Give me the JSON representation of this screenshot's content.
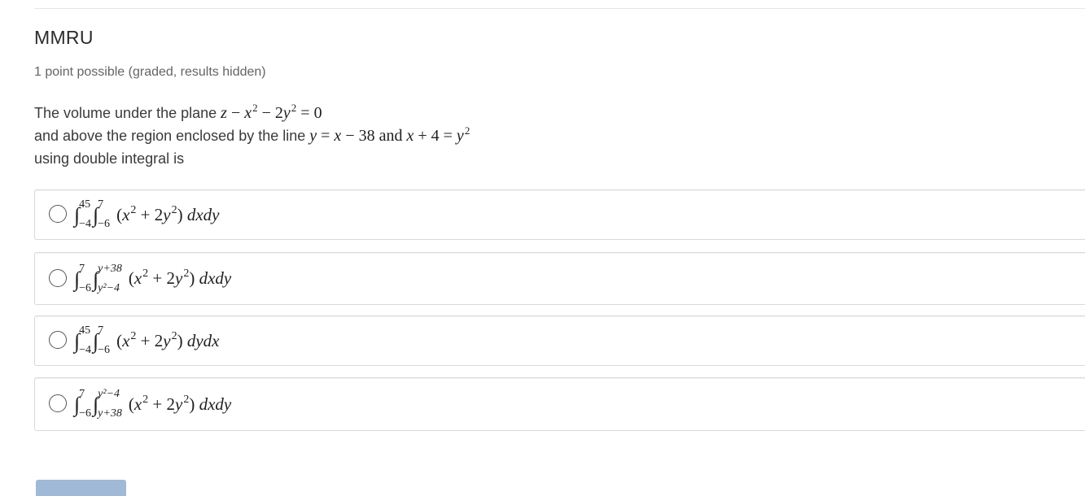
{
  "problem": {
    "title": "MMRU",
    "meta": "1 point possible (graded, results hidden)",
    "line1_text": "The volume under the plane ",
    "line1_math": {
      "a": "z",
      "op1": " − ",
      "b": "x",
      "exp1": "2",
      "op2": " − 2",
      "c": "y",
      "exp2": "2",
      "eq": " = 0"
    },
    "line2_text": "and above the region enclosed by the line ",
    "line2_math": {
      "y": "y",
      "eq": " = ",
      "x": "x",
      "rest": " − 38 and ",
      "x2": "x",
      "rest2": " + 4 = ",
      "y2": "y",
      "exp": "2"
    },
    "line3_text": "using double integral is"
  },
  "options": [
    {
      "outer": {
        "upper": "45",
        "lower": "−4"
      },
      "inner": {
        "upper": "7",
        "lower": "−6"
      },
      "integrand": {
        "open": "(",
        "x": "x",
        "exp1": "2",
        "plus": " + 2",
        "y": "y",
        "exp2": "2",
        "close": ")"
      },
      "diff": "dxdy"
    },
    {
      "outer": {
        "upper": "7",
        "lower": "−6"
      },
      "inner": {
        "upper": "y+38",
        "lower": "y²−4"
      },
      "integrand": {
        "open": "(",
        "x": "x",
        "exp1": "2",
        "plus": " + 2",
        "y": "y",
        "exp2": "2",
        "close": ")"
      },
      "diff": "dxdy"
    },
    {
      "outer": {
        "upper": "45",
        "lower": "−4"
      },
      "inner": {
        "upper": "7",
        "lower": "−6"
      },
      "integrand": {
        "open": "(",
        "x": "x",
        "exp1": "2",
        "plus": " + 2",
        "y": "y",
        "exp2": "2",
        "close": ")"
      },
      "diff": "dydx"
    },
    {
      "outer": {
        "upper": "7",
        "lower": "−6"
      },
      "inner": {
        "upper": "y²−4",
        "lower": "y+38"
      },
      "integrand": {
        "open": "(",
        "x": "x",
        "exp1": "2",
        "plus": " + 2",
        "y": "y",
        "exp2": "2",
        "close": ")"
      },
      "diff": "dxdy"
    }
  ],
  "icons": {
    "radio": "radio-unselected-icon"
  },
  "colors": {
    "border": "#d9d9d9",
    "submit": "#9fb9d6",
    "text": "#313131"
  }
}
